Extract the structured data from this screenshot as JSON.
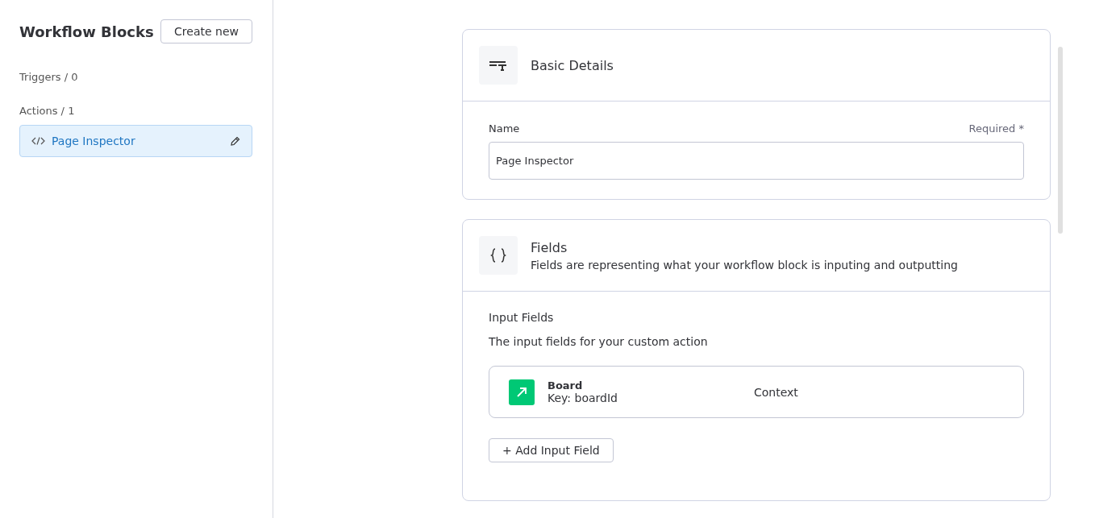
{
  "sidebar": {
    "title": "Workflow Blocks",
    "create_button": "Create new",
    "sections": [
      {
        "label": "Triggers / 0"
      },
      {
        "label": "Actions / 1",
        "items": [
          {
            "label": "Page Inspector",
            "selected": true
          }
        ]
      }
    ]
  },
  "basic_details": {
    "title": "Basic Details",
    "name_label": "Name",
    "required_label": "Required *",
    "name_value": "Page Inspector"
  },
  "fields": {
    "title": "Fields",
    "description": "Fields are representing what your workflow block is inputing and outputting",
    "input_title": "Input Fields",
    "input_description": "The input fields for your custom action",
    "input_fields": [
      {
        "name": "Board",
        "key": "Key: boardId",
        "type": "Context"
      }
    ],
    "add_button": "+ Add Input Field"
  }
}
